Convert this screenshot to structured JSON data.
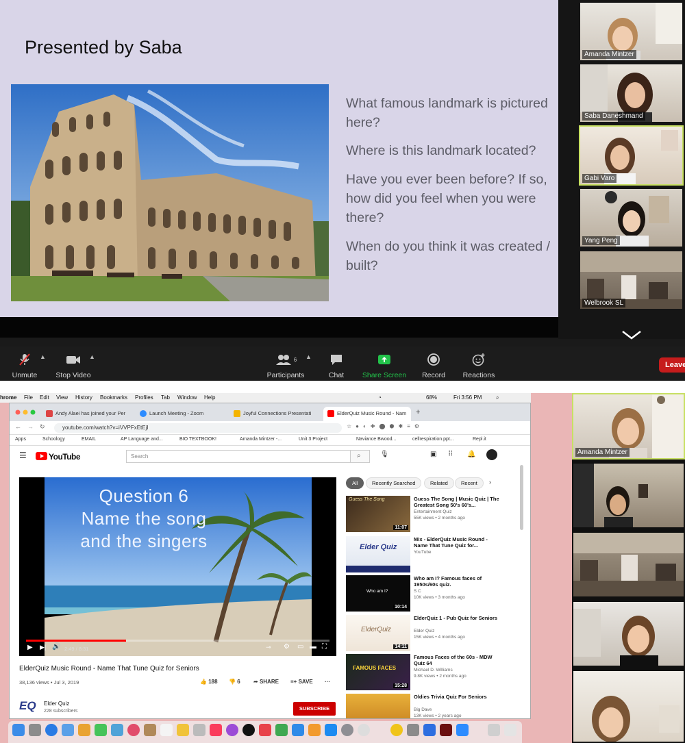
{
  "slide": {
    "title": "Presented by Saba",
    "questions": [
      "What famous landmark is pictured here?",
      "Where is this landmark located?",
      "Have you ever been before? If so, how did you feel when you were there?",
      "When do you think it was created / built?"
    ]
  },
  "participants": [
    "Amanda Mintzer",
    "Saba Daneshmand",
    "Gabi Varo",
    "Yang Peng",
    "Welbrook SL"
  ],
  "toolbar": {
    "unmute": "Unmute",
    "stop_video": "Stop Video",
    "participants": "Participants",
    "participant_count": "6",
    "chat": "Chat",
    "share_screen": "Share Screen",
    "record": "Record",
    "reactions": "Reactions",
    "leave": "Leave"
  },
  "mac_menu": {
    "app": "hrome",
    "items": [
      "File",
      "Edit",
      "View",
      "History",
      "Bookmarks",
      "Profiles",
      "Tab",
      "Window",
      "Help"
    ],
    "battery": "68%",
    "clock": "Fri 3:56 PM"
  },
  "browser": {
    "tabs": [
      "Andy Alaei has joined your Per",
      "Launch Meeting - Zoom",
      "Joyful Connections Presentati",
      "ElderQuiz Music Round - Nam"
    ],
    "url": "youtube.com/watch?v=iVVPFxEtEjI",
    "bookmarks": [
      "Apps",
      "Schoology",
      "EMAIL",
      "AP Language and...",
      "BIO TEXTBOOK!",
      "Amanda Mintzer -...",
      "Unit 3 Project",
      "Naviance Bwood...",
      "cellrespiration.ppt...",
      "Repl.it"
    ]
  },
  "youtube": {
    "logo": "YouTube",
    "search_placeholder": "Search",
    "video_text": [
      "Question 6",
      "Name the song",
      "and the singers"
    ],
    "time": "2:49 / 8:31",
    "progress": 0.33,
    "video_title": "ElderQuiz Music Round - Name That Tune Quiz for Seniors",
    "views_date": "38,136 views • Jul 3, 2019",
    "likes": "188",
    "dislikes": "6",
    "share": "SHARE",
    "save": "SAVE",
    "channel": "Elder Quiz",
    "channel_logo": "EQ",
    "subscribers": "228 subscribers",
    "subscribe": "SUBSCRIBE",
    "chips": [
      "All",
      "Recently Searched",
      "Related",
      "Recent"
    ],
    "recommendations": [
      {
        "title": "Guess The Song | Music Quiz | The Greatest Song 50's 60's...",
        "channel": "Entertainment Quiz",
        "views": "55K views • 2 months ago",
        "duration": "11:07",
        "thumb_text": "Guess The Song"
      },
      {
        "title": "Mix - ElderQuiz Music Round - Name That Tune Quiz for...",
        "channel": "YouTube",
        "views": "",
        "duration": "",
        "thumb_text": "Elder Quiz"
      },
      {
        "title": "Who am I? Famous faces of 1950s/60s quiz.",
        "channel": "S C",
        "views": "10K views • 3 months ago",
        "duration": "10:14",
        "thumb_text": "Who am I?"
      },
      {
        "title": "ElderQuiz 1 - Pub Quiz for Seniors",
        "channel": "Elder Quiz",
        "views": "15K views • 4 months ago",
        "duration": "14:11",
        "thumb_text": "ElderQuiz"
      },
      {
        "title": "Famous Faces of the 60s - MDW Quiz 64",
        "channel": "Michael D. Williams",
        "views": "9.8K views • 2 months ago",
        "duration": "15:28",
        "thumb_text": "FAMOUS FACES"
      },
      {
        "title": "Oldies Trivia Quiz For Seniors",
        "channel": "Big Dave",
        "views": "13K views • 2 years ago",
        "duration": "",
        "thumb_text": ""
      }
    ]
  },
  "gallery2": {
    "top_name": "Amanda Mintzer"
  },
  "colors": {
    "slide_bg": "#d9d5e8",
    "zoom_dark": "#1c1c1c",
    "share_green": "#22c24a",
    "active_speaker": "#c8e063",
    "leave_red": "#c61c1c",
    "youtube_red": "#ff0000"
  }
}
